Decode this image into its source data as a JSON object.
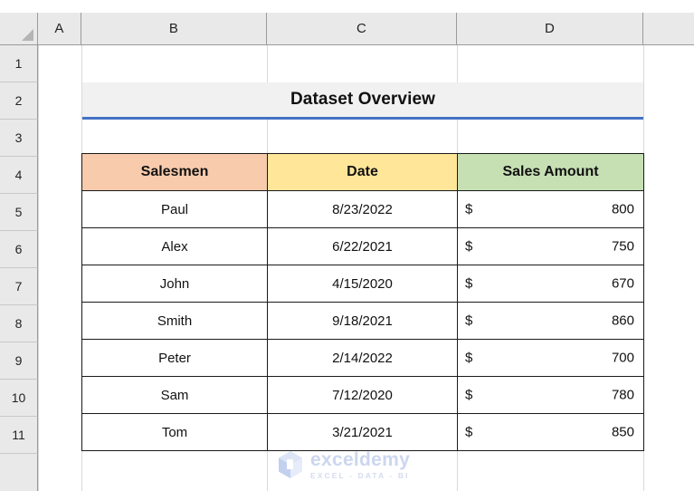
{
  "app": "spreadsheet",
  "grid": {
    "column_headers": [
      "A",
      "B",
      "C",
      "D"
    ],
    "row_headers": [
      "1",
      "2",
      "3",
      "4",
      "5",
      "6",
      "7",
      "8",
      "9",
      "10",
      "11"
    ]
  },
  "title_banner": {
    "text": "Dataset Overview",
    "background": "#f1f1f1",
    "underline_color": "#4472c4"
  },
  "table": {
    "headers": [
      {
        "label": "Salesmen",
        "background": "#f8cbad"
      },
      {
        "label": "Date",
        "background": "#ffe699"
      },
      {
        "label": "Sales Amount",
        "background": "#c6e0b4"
      }
    ],
    "rows": [
      {
        "salesman": "Paul",
        "date": "8/23/2022",
        "currency": "$",
        "amount": "800"
      },
      {
        "salesman": "Alex",
        "date": "6/22/2021",
        "currency": "$",
        "amount": "750"
      },
      {
        "salesman": "John",
        "date": "4/15/2020",
        "currency": "$",
        "amount": "670"
      },
      {
        "salesman": "Smith",
        "date": "9/18/2021",
        "currency": "$",
        "amount": "860"
      },
      {
        "salesman": "Peter",
        "date": "2/14/2022",
        "currency": "$",
        "amount": "700"
      },
      {
        "salesman": "Sam",
        "date": "7/12/2020",
        "currency": "$",
        "amount": "780"
      },
      {
        "salesman": "Tom",
        "date": "3/21/2021",
        "currency": "$",
        "amount": "850"
      }
    ]
  },
  "watermark": {
    "name": "exceldemy",
    "tagline": "EXCEL - DATA - BI",
    "color": "#ccd6ef",
    "icon": "hexagon-cube-logo"
  }
}
